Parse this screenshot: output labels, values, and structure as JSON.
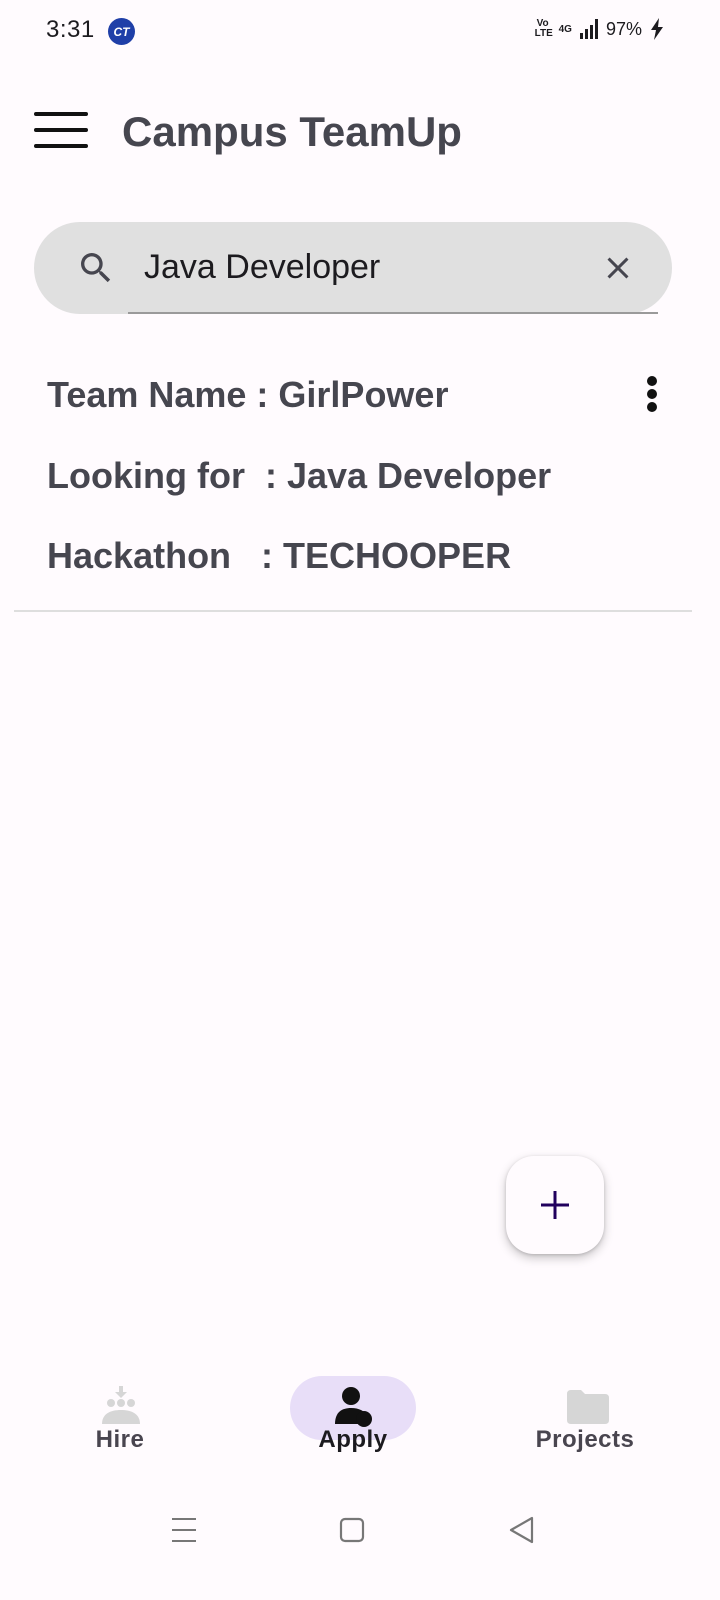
{
  "status_bar": {
    "time": "3:31",
    "app_badge": "CT",
    "volte": "Vo\nLTE",
    "network": "4G",
    "battery": "97%"
  },
  "app_bar": {
    "title": "Campus TeamUp"
  },
  "search": {
    "value": "Java Developer",
    "placeholder": ""
  },
  "team_card": {
    "team_name": "Team Name : GirlPower",
    "looking_for": "Looking for  : Java Developer",
    "hackathon": "Hackathon   : TECHOOPER"
  },
  "bottom_nav": {
    "items": [
      {
        "label": "Hire",
        "icon": "hire-icon",
        "selected": false
      },
      {
        "label": "Apply",
        "icon": "person-icon",
        "selected": true
      },
      {
        "label": "Projects",
        "icon": "folder-icon",
        "selected": false
      }
    ]
  },
  "colors": {
    "accent": "#e8def8",
    "fab_plus": "#21005d",
    "background": "#fffbfe",
    "search_bg": "#e0e0e0"
  }
}
